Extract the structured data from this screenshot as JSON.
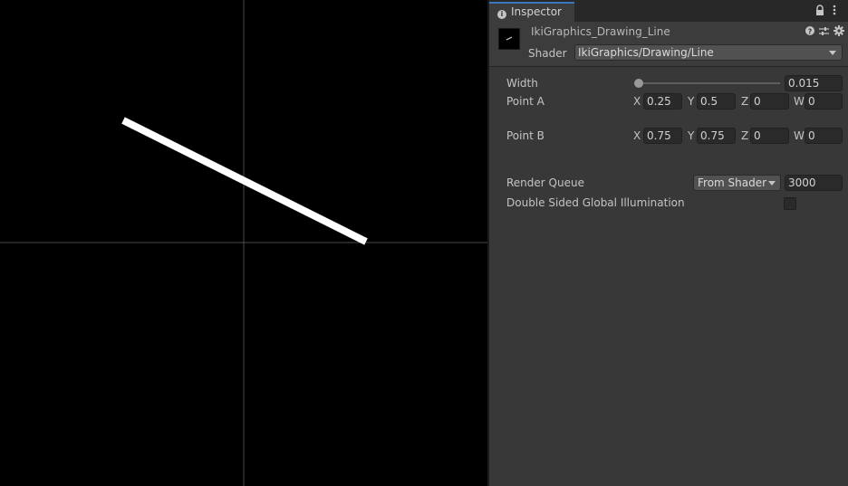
{
  "inspector": {
    "tab_label": "Inspector",
    "material_name": "IkiGraphics_Drawing_Line",
    "shader_label": "Shader",
    "shader_value": "IkiGraphics/Drawing/Line"
  },
  "properties": {
    "width": {
      "label": "Width",
      "value": "0.015",
      "slider_fraction": 0.0
    },
    "point_a": {
      "label": "Point A",
      "x": "0.25",
      "y": "0.5",
      "z": "0",
      "w": "0"
    },
    "point_b": {
      "label": "Point B",
      "x": "0.75",
      "y": "0.75",
      "z": "0",
      "w": "0"
    },
    "axis_labels": {
      "x": "X",
      "y": "Y",
      "z": "Z",
      "w": "W"
    },
    "render_queue": {
      "label": "Render Queue",
      "mode": "From Shader",
      "value": "3000"
    },
    "double_sided_gi": {
      "label": "Double Sided Global Illumination",
      "checked": false
    }
  },
  "icons": {
    "tab": "info-icon",
    "lock": "lock-icon",
    "menu": "kebab-menu-icon",
    "help": "help-icon",
    "preset": "preset-icon",
    "settings": "gear-icon"
  },
  "colors": {
    "panel_bg": "#383838",
    "tab_accent": "#3a79bb",
    "scene_bg": "#000000",
    "line_color": "#ffffff",
    "crosshair": "#4a4a4a"
  }
}
